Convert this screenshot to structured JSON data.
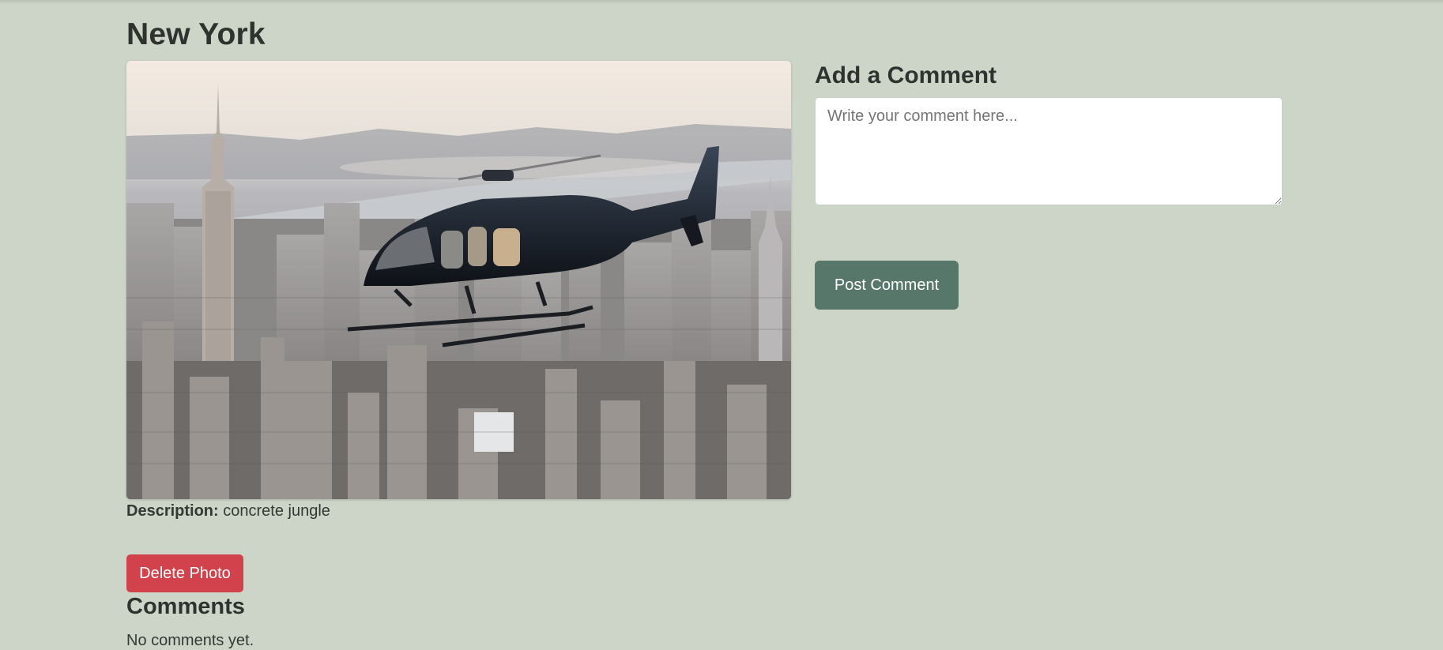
{
  "page": {
    "title": "New York"
  },
  "photo": {
    "alt": "Helicopter flying over New York City skyline",
    "description_label": "Description:",
    "description_value": "concrete jungle",
    "delete_label": "Delete Photo"
  },
  "comments": {
    "heading": "Comments",
    "empty_text": "No comments yet."
  },
  "add_comment": {
    "heading": "Add a Comment",
    "placeholder": "Write your comment here...",
    "submit_label": "Post Comment"
  },
  "colors": {
    "background": "#ccd5c8",
    "delete_button": "#d2424c",
    "post_button": "#57776b"
  }
}
